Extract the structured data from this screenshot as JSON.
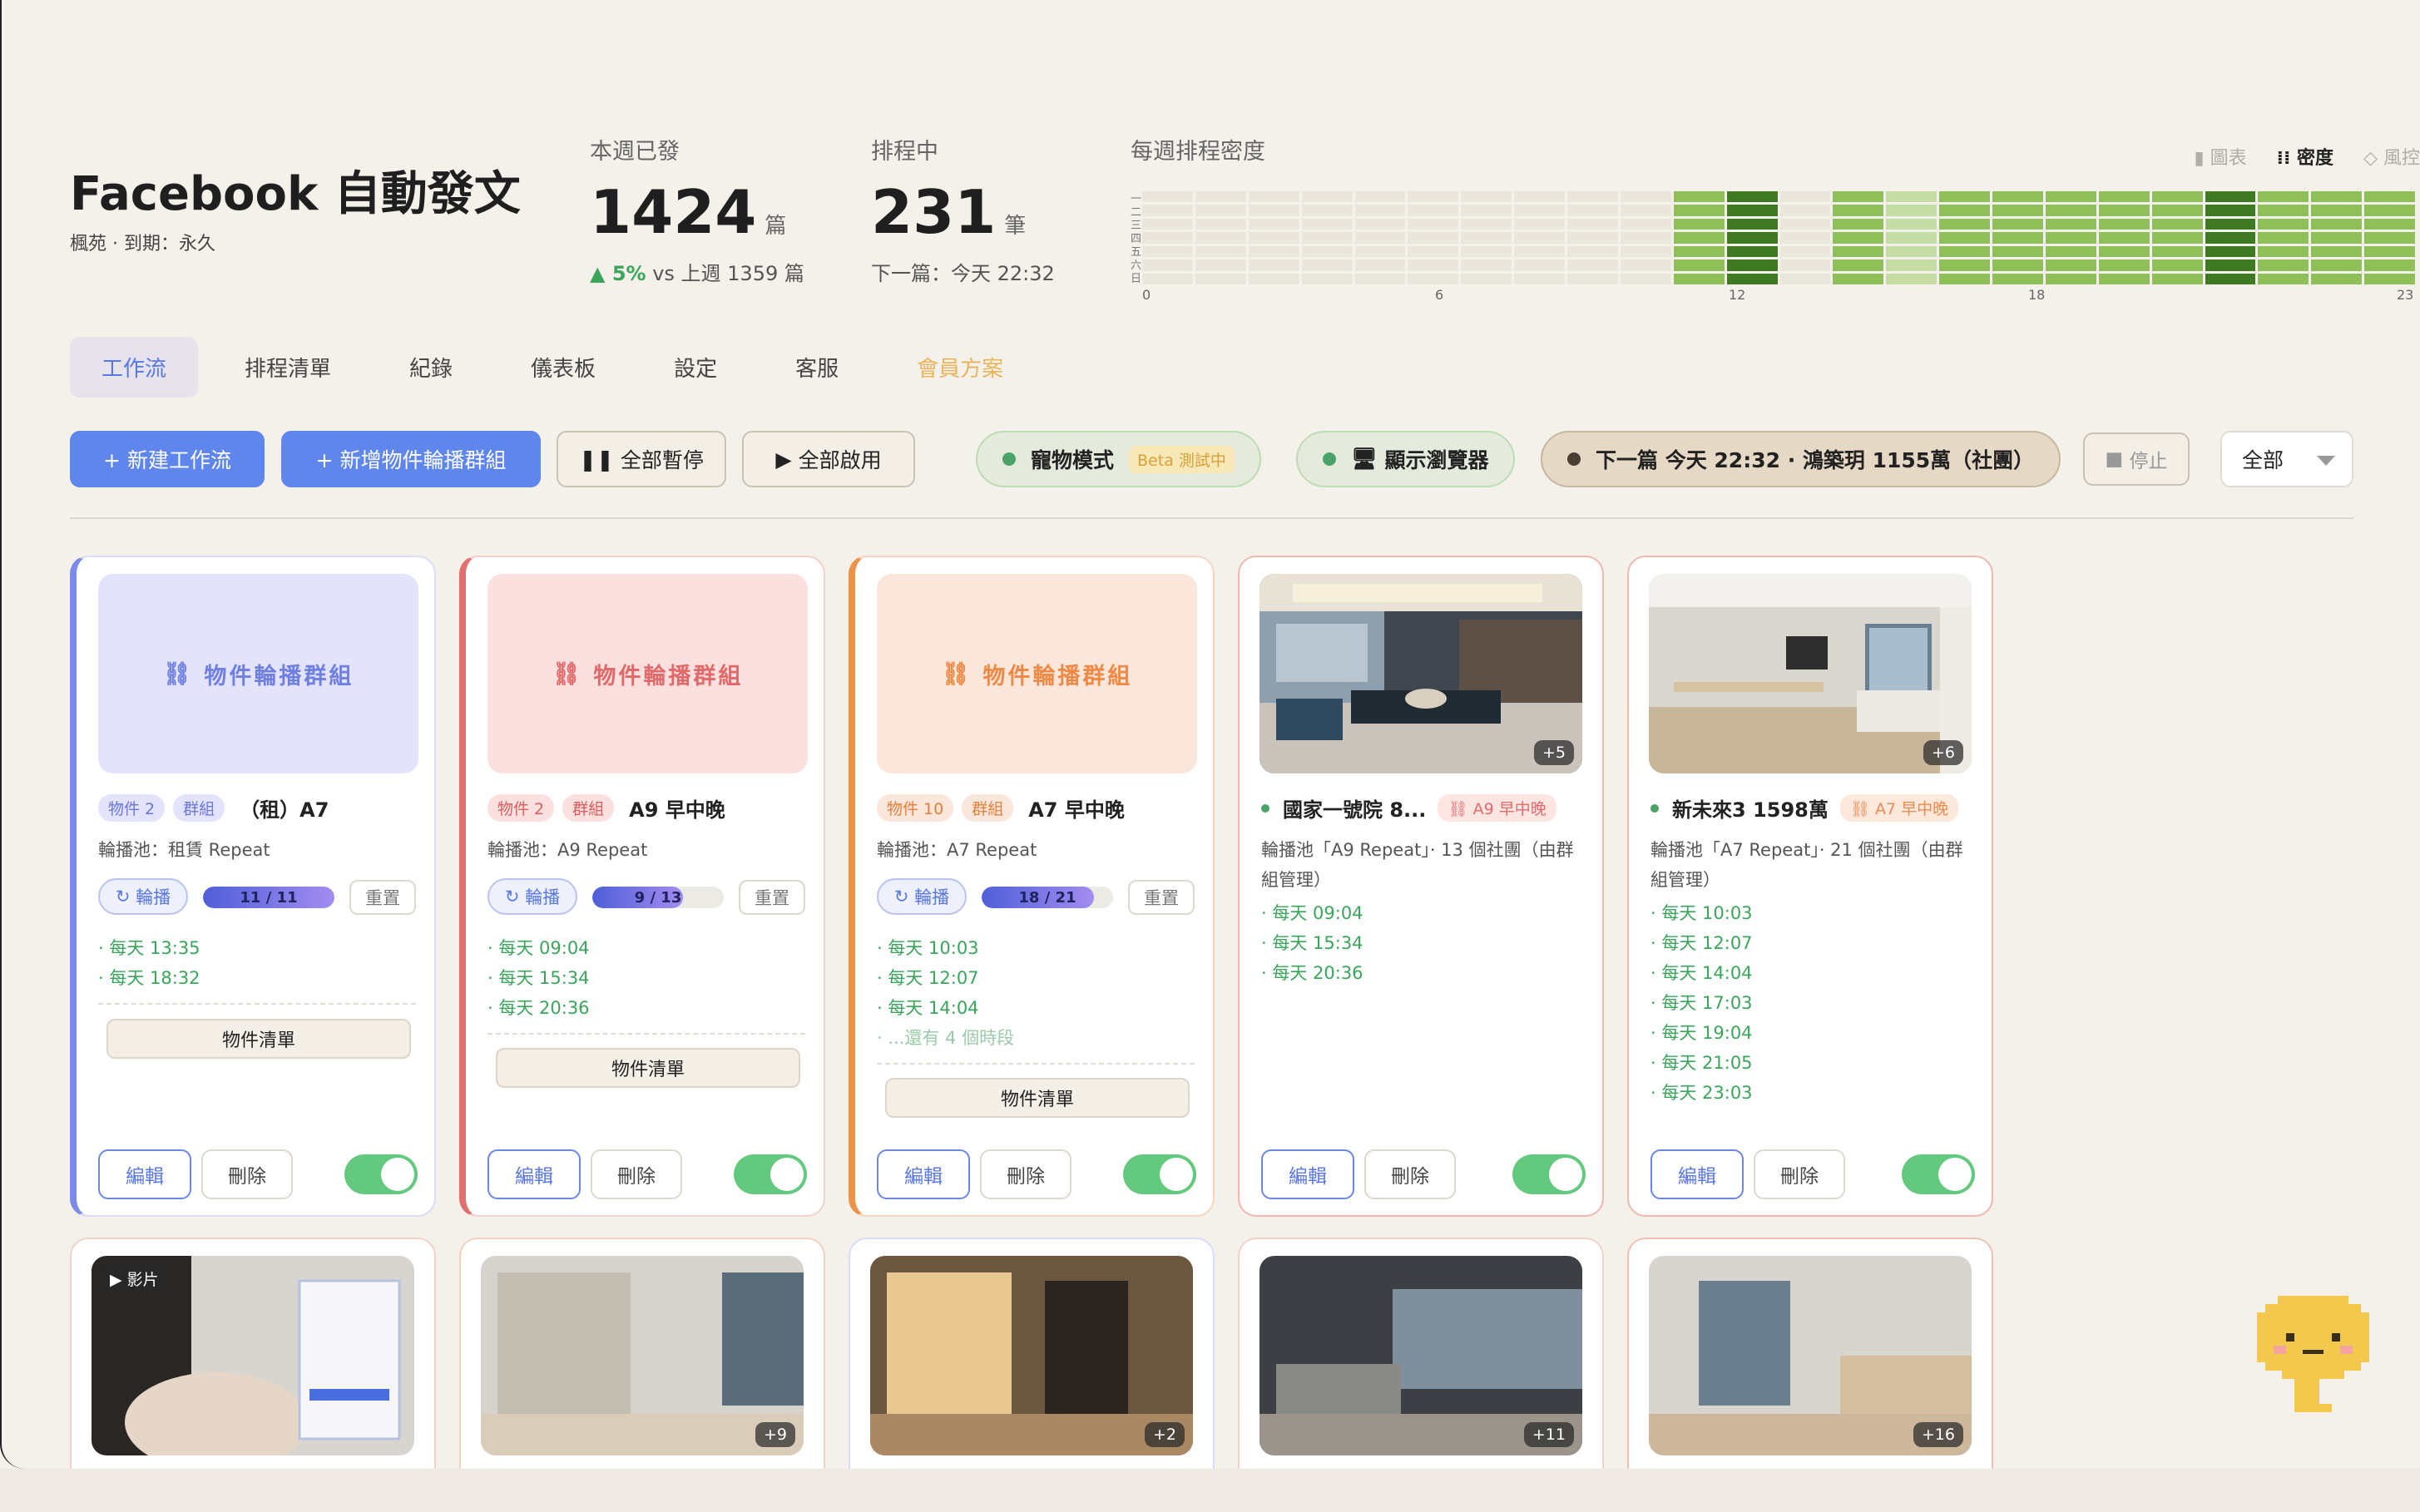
{
  "app": {
    "title": "Facebook 自動發文",
    "subtitle": "楓苑 · 到期：永久"
  },
  "stats": [
    {
      "label": "本週已發",
      "value": "1424",
      "unit": "篇",
      "foot_prefix": "▲ 5%",
      "foot_rest": " vs 上週 1359 篇"
    },
    {
      "label": "排程中",
      "value": "231",
      "unit": "筆",
      "foot_prefix": "",
      "foot_rest": "下一篇：今天 22:32"
    }
  ],
  "heatmap": {
    "title": "每週排程密度",
    "day_labels": [
      "一",
      "二",
      "三",
      "四",
      "五",
      "六",
      "日"
    ],
    "hour_labels": [
      "0",
      "6",
      "12",
      "18",
      "23"
    ],
    "levels": [
      0,
      0,
      0,
      0,
      0,
      0,
      0,
      0,
      0,
      0,
      2,
      4,
      0,
      2,
      1,
      2,
      2,
      2,
      2,
      2,
      4,
      2,
      2,
      2
    ],
    "colors": {
      "0": "#ebe6dc",
      "1": "#c5dca4",
      "2": "#8fbf59",
      "3": "#5e9a35",
      "4": "#3f7a22"
    }
  },
  "view_tabs": [
    {
      "label": "圖表",
      "icon": "bar-chart-icon"
    },
    {
      "label": "密度",
      "icon": "grid-icon"
    },
    {
      "label": "風控",
      "icon": "shield-icon"
    }
  ],
  "tabs": [
    "工作流",
    "排程清單",
    "紀錄",
    "儀表板",
    "設定",
    "客服",
    "會員方案"
  ],
  "toolbar": {
    "new_workflow": "+ 新建工作流",
    "new_group": "+ 新增物件輪播群組",
    "pause_all": "全部暫停",
    "start_all": "全部啟用",
    "pet_mode": "寵物模式",
    "beta": "Beta 測試中",
    "show_browser": "顯示瀏覽器",
    "next_post": "下一篇 今天 22:32 · 鴻築玥 1155萬（社團）",
    "stop": "停止",
    "filter": "全部"
  },
  "cards": [
    {
      "type": "group",
      "cover": "物件輪播群組",
      "tag1": "物件 2",
      "tag2": "群組",
      "name": "（租）A7",
      "pool": "輪播池：租賃 Repeat",
      "rotate": "輪播",
      "progress": "11 / 11",
      "progress_value": 1.0,
      "reset": "重置",
      "times": [
        "· 每天 13:35",
        "· 每天 18:32"
      ],
      "more": "",
      "list": "物件清單",
      "edit": "編輯",
      "delete": "刪除",
      "enabled": true
    },
    {
      "type": "group",
      "cover": "物件輪播群組",
      "tag1": "物件 2",
      "tag2": "群組",
      "name": "A9 早中晚",
      "pool": "輪播池：A9 Repeat",
      "rotate": "輪播",
      "progress": "9 / 13",
      "progress_value": 0.6923,
      "reset": "重置",
      "times": [
        "· 每天 09:04",
        "· 每天 15:34",
        "· 每天 20:36"
      ],
      "more": "",
      "list": "物件清單",
      "edit": "編輯",
      "delete": "刪除",
      "enabled": true
    },
    {
      "type": "group",
      "cover": "物件輪播群組",
      "tag1": "物件 10",
      "tag2": "群組",
      "name": "A7 早中晚",
      "pool": "輪播池：A7 Repeat",
      "rotate": "輪播",
      "progress": "18 / 21",
      "progress_value": 0.857,
      "reset": "重置",
      "times": [
        "· 每天 10:03",
        "· 每天 12:07",
        "· 每天 14:04"
      ],
      "more": "· ...還有 4 個時段",
      "list": "物件清單",
      "edit": "編輯",
      "delete": "刪除",
      "enabled": true
    },
    {
      "type": "property",
      "name": "國家一號院 8...",
      "group_tag": "A9 早中晚",
      "pool": "輪播池「A9 Repeat」· 13 個社團（由群組管理）",
      "photo_count": "+5",
      "times": [
        "· 每天 09:04",
        "· 每天 15:34",
        "· 每天 20:36"
      ],
      "edit": "編輯",
      "delete": "刪除",
      "enabled": true
    },
    {
      "type": "property",
      "name": "新未來3 1598萬",
      "group_tag": "A7 早中晚",
      "pool": "輪播池「A7 Repeat」· 21 個社團（由群組管理）",
      "photo_count": "+6",
      "times": [
        "· 每天 10:03",
        "· 每天 12:07",
        "· 每天 14:04",
        "· 每天 17:03",
        "· 每天 19:04",
        "· 每天 21:05",
        "· 每天 23:03"
      ],
      "edit": "編輯",
      "delete": "刪除",
      "enabled": true
    }
  ],
  "row2": [
    {
      "badge": "影片",
      "count": ""
    },
    {
      "badge": "",
      "count": "+9"
    },
    {
      "badge": "",
      "count": "+2"
    },
    {
      "badge": "",
      "count": "+11"
    },
    {
      "badge": "",
      "count": "+16"
    }
  ]
}
